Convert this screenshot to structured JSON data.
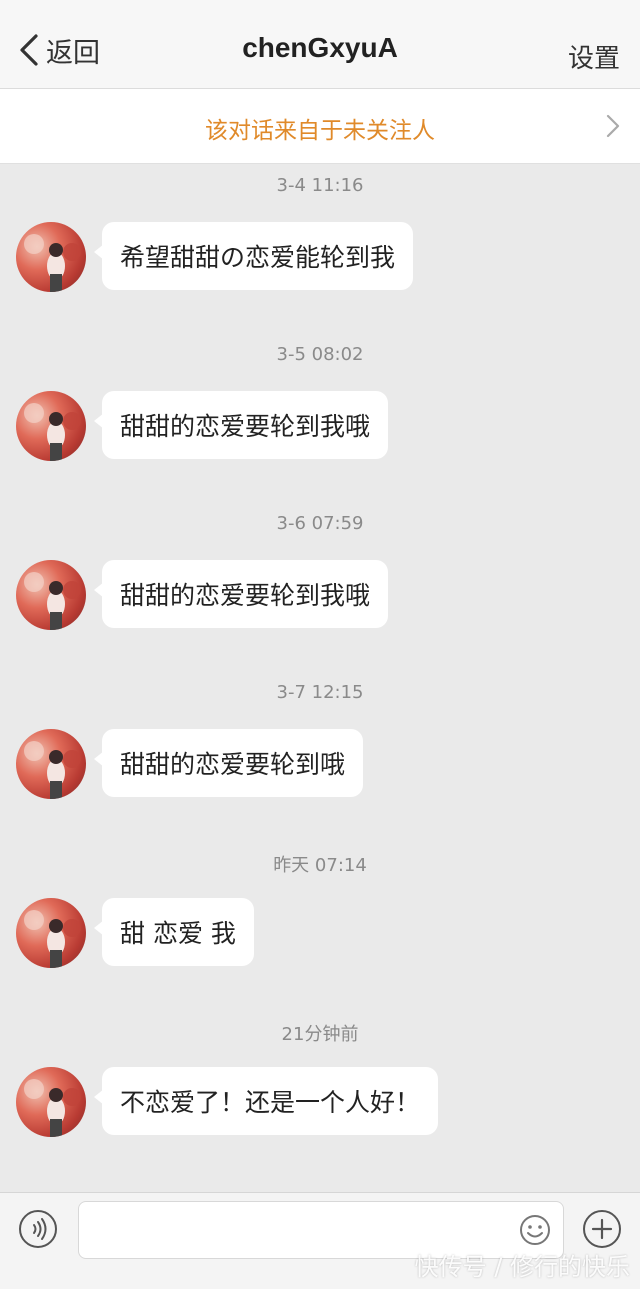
{
  "nav": {
    "back_label": "返回",
    "title": "chenGxyuA",
    "settings_label": "设置"
  },
  "notice": {
    "text": "该对话来自于未关注人"
  },
  "messages": [
    {
      "time": "3-4 11:16",
      "text": "希望甜甜の恋爱能轮到我"
    },
    {
      "time": "3-5 08:02",
      "text": "甜甜的恋爱要轮到我哦"
    },
    {
      "time": "3-6 07:59",
      "text": "甜甜的恋爱要轮到我哦"
    },
    {
      "time": "3-7 12:15",
      "text": "甜甜的恋爱要轮到哦"
    },
    {
      "time": "昨天 07:14",
      "text": "甜 恋爱 我"
    },
    {
      "time": "21分钟前",
      "text": "不恋爱了！还是一个人好！"
    }
  ],
  "input": {
    "placeholder": ""
  },
  "watermark": "快传号 / 修行的快乐",
  "colors": {
    "notice_text": "#e08a2a",
    "background": "#eaeaea",
    "bubble": "#ffffff"
  }
}
